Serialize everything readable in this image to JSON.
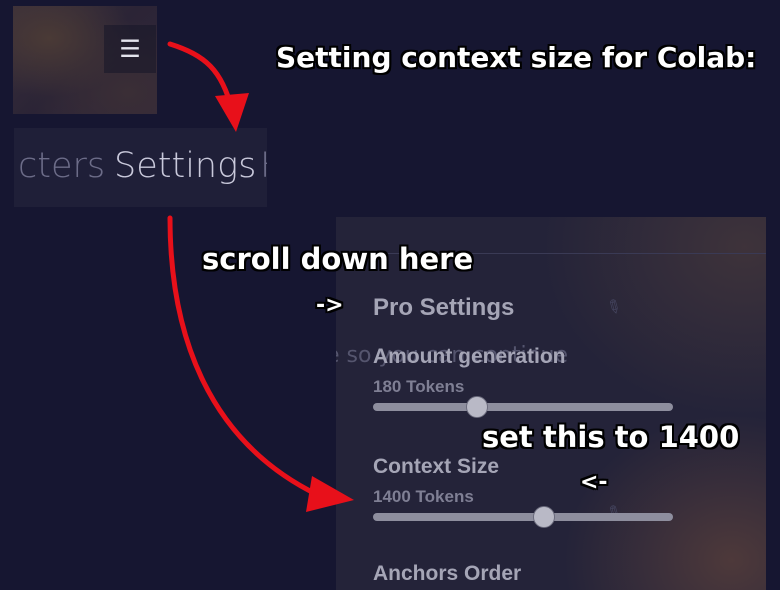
{
  "top_tabs": {
    "prev_fragment": "cters",
    "current": "Settings",
    "next_fragment": "H"
  },
  "menu": {
    "icon": "hamburger-menu-icon",
    "glyph": "☰"
  },
  "panel": {
    "ghost_text": "e so you can continue",
    "section_title": "Pro Settings",
    "amount_generation": {
      "label": "Amount generation",
      "value_text": "180 Tokens",
      "value": 180,
      "fraction": 0.345
    },
    "context_size": {
      "label": "Context Size",
      "value_text": "1400 Tokens",
      "value": 1400,
      "fraction": 0.57
    },
    "next_section": "Anchors Order"
  },
  "annotations": {
    "title": "Setting context size for Colab:",
    "scroll_hint": "scroll down here",
    "arrow_right": "->",
    "set_hint": "set this to 1400",
    "arrow_left": "<-"
  },
  "colors": {
    "background": "#161631",
    "panel": "#242339",
    "arrow_red": "#e8101a"
  }
}
